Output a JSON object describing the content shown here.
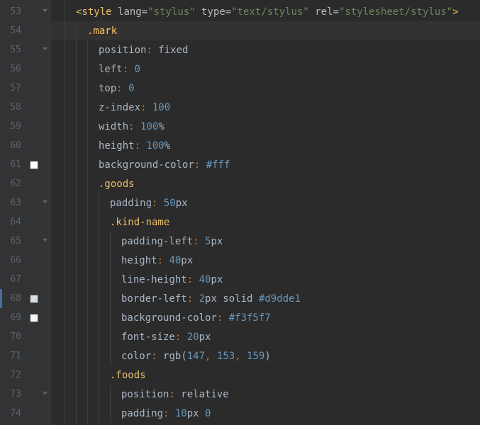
{
  "lines": [
    {
      "num": "53",
      "fold": "open",
      "indent": 1,
      "tokens": [
        {
          "t": "<style ",
          "c": "t-tag"
        },
        {
          "t": "lang",
          "c": "t-attr"
        },
        {
          "t": "=",
          "c": "t-attr"
        },
        {
          "t": "\"stylus\"",
          "c": "t-str"
        },
        {
          "t": " ",
          "c": ""
        },
        {
          "t": "type",
          "c": "t-attr"
        },
        {
          "t": "=",
          "c": "t-attr"
        },
        {
          "t": "\"text/stylus\"",
          "c": "t-str"
        },
        {
          "t": " ",
          "c": ""
        },
        {
          "t": "rel",
          "c": "t-attr"
        },
        {
          "t": "=",
          "c": "t-attr"
        },
        {
          "t": "\"stylesheet/stylus\"",
          "c": "t-str"
        },
        {
          "t": ">",
          "c": "t-tag"
        }
      ]
    },
    {
      "num": "54",
      "highlight": true,
      "indent": 2,
      "tokens": [
        {
          "t": ".",
          "c": "t-sel"
        },
        {
          "t": "mark",
          "c": "t-selhl"
        }
      ]
    },
    {
      "num": "55",
      "fold": "open",
      "indent": 3,
      "tokens": [
        {
          "t": "position",
          "c": "t-prop"
        },
        {
          "t": ": ",
          "c": "t-punc"
        },
        {
          "t": "fixed",
          "c": "t-val"
        }
      ]
    },
    {
      "num": "56",
      "indent": 3,
      "tokens": [
        {
          "t": "left",
          "c": "t-prop"
        },
        {
          "t": ": ",
          "c": "t-punc"
        },
        {
          "t": "0",
          "c": "t-num"
        }
      ]
    },
    {
      "num": "57",
      "indent": 3,
      "tokens": [
        {
          "t": "top",
          "c": "t-prop"
        },
        {
          "t": ": ",
          "c": "t-punc"
        },
        {
          "t": "0",
          "c": "t-num"
        }
      ]
    },
    {
      "num": "58",
      "indent": 3,
      "tokens": [
        {
          "t": "z-index",
          "c": "t-prop"
        },
        {
          "t": ": ",
          "c": "t-punc"
        },
        {
          "t": "100",
          "c": "t-num"
        }
      ]
    },
    {
      "num": "59",
      "indent": 3,
      "tokens": [
        {
          "t": "width",
          "c": "t-prop"
        },
        {
          "t": ": ",
          "c": "t-punc"
        },
        {
          "t": "100",
          "c": "t-num"
        },
        {
          "t": "%",
          "c": "t-unit"
        }
      ]
    },
    {
      "num": "60",
      "indent": 3,
      "tokens": [
        {
          "t": "height",
          "c": "t-prop"
        },
        {
          "t": ": ",
          "c": "t-punc"
        },
        {
          "t": "100",
          "c": "t-num"
        },
        {
          "t": "%",
          "c": "t-unit"
        }
      ]
    },
    {
      "num": "61",
      "swatch": "#ffffff",
      "indent": 3,
      "tokens": [
        {
          "t": "background-color",
          "c": "t-prop"
        },
        {
          "t": ": ",
          "c": "t-punc"
        },
        {
          "t": "#fff",
          "c": "t-hex"
        }
      ]
    },
    {
      "num": "62",
      "indent": 3,
      "tokens": [
        {
          "t": ".goods",
          "c": "t-sel"
        }
      ]
    },
    {
      "num": "63",
      "fold": "open",
      "indent": 4,
      "tokens": [
        {
          "t": "padding",
          "c": "t-prop"
        },
        {
          "t": ": ",
          "c": "t-punc"
        },
        {
          "t": "50",
          "c": "t-num"
        },
        {
          "t": "px",
          "c": "t-unit"
        }
      ]
    },
    {
      "num": "64",
      "indent": 4,
      "tokens": [
        {
          "t": ".kind-name",
          "c": "t-sel"
        }
      ]
    },
    {
      "num": "65",
      "fold": "open",
      "indent": 5,
      "tokens": [
        {
          "t": "padding-left",
          "c": "t-prop"
        },
        {
          "t": ": ",
          "c": "t-punc"
        },
        {
          "t": "5",
          "c": "t-num"
        },
        {
          "t": "px",
          "c": "t-unit"
        }
      ]
    },
    {
      "num": "66",
      "indent": 5,
      "tokens": [
        {
          "t": "height",
          "c": "t-prop"
        },
        {
          "t": ": ",
          "c": "t-punc"
        },
        {
          "t": "40",
          "c": "t-num"
        },
        {
          "t": "px",
          "c": "t-unit"
        }
      ]
    },
    {
      "num": "67",
      "indent": 5,
      "tokens": [
        {
          "t": "line-height",
          "c": "t-prop"
        },
        {
          "t": ": ",
          "c": "t-punc"
        },
        {
          "t": "40",
          "c": "t-num"
        },
        {
          "t": "px",
          "c": "t-unit"
        }
      ]
    },
    {
      "num": "68",
      "swatch": "#d9dde1",
      "bluebar": true,
      "indent": 5,
      "tokens": [
        {
          "t": "border-left",
          "c": "t-prop"
        },
        {
          "t": ": ",
          "c": "t-punc"
        },
        {
          "t": "2",
          "c": "t-num"
        },
        {
          "t": "px ",
          "c": "t-unit"
        },
        {
          "t": "solid ",
          "c": "t-val"
        },
        {
          "t": "#d9dde1",
          "c": "t-hex"
        }
      ]
    },
    {
      "num": "69",
      "swatch": "#f3f5f7",
      "indent": 5,
      "tokens": [
        {
          "t": "background-color",
          "c": "t-prop"
        },
        {
          "t": ": ",
          "c": "t-punc"
        },
        {
          "t": "#f3f5f7",
          "c": "t-hex"
        }
      ]
    },
    {
      "num": "70",
      "indent": 5,
      "tokens": [
        {
          "t": "font-size",
          "c": "t-prop"
        },
        {
          "t": ": ",
          "c": "t-punc"
        },
        {
          "t": "20",
          "c": "t-num"
        },
        {
          "t": "px",
          "c": "t-unit"
        }
      ]
    },
    {
      "num": "71",
      "indent": 5,
      "tokens": [
        {
          "t": "color",
          "c": "t-prop"
        },
        {
          "t": ": ",
          "c": "t-punc"
        },
        {
          "t": "rgb",
          "c": "t-val"
        },
        {
          "t": "(",
          "c": "t-paren"
        },
        {
          "t": "147",
          "c": "t-num"
        },
        {
          "t": ", ",
          "c": "t-comma"
        },
        {
          "t": "153",
          "c": "t-num"
        },
        {
          "t": ", ",
          "c": "t-comma"
        },
        {
          "t": "159",
          "c": "t-num"
        },
        {
          "t": ")",
          "c": "t-paren"
        }
      ]
    },
    {
      "num": "72",
      "indent": 4,
      "tokens": [
        {
          "t": ".foods",
          "c": "t-sel"
        }
      ]
    },
    {
      "num": "73",
      "fold": "open",
      "indent": 5,
      "tokens": [
        {
          "t": "position",
          "c": "t-prop"
        },
        {
          "t": ": ",
          "c": "t-punc"
        },
        {
          "t": "relative",
          "c": "t-val"
        }
      ]
    },
    {
      "num": "74",
      "indent": 5,
      "tokens": [
        {
          "t": "padding",
          "c": "t-prop"
        },
        {
          "t": ": ",
          "c": "t-punc"
        },
        {
          "t": "10",
          "c": "t-num"
        },
        {
          "t": "px ",
          "c": "t-unit"
        },
        {
          "t": "0",
          "c": "t-num"
        }
      ]
    }
  ]
}
